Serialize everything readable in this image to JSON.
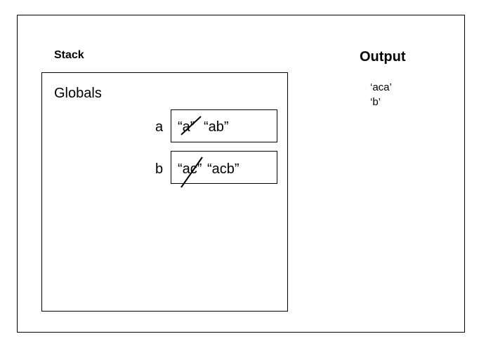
{
  "stack": {
    "title": "Stack",
    "frame_label": "Globals",
    "variables": [
      {
        "name": "a",
        "old_value": "“a”",
        "new_value": "“ab”"
      },
      {
        "name": "b",
        "old_value": "“ac”",
        "new_value": "“acb”"
      }
    ]
  },
  "output": {
    "title": "Output",
    "lines": [
      "‘aca’",
      "‘b’"
    ]
  }
}
